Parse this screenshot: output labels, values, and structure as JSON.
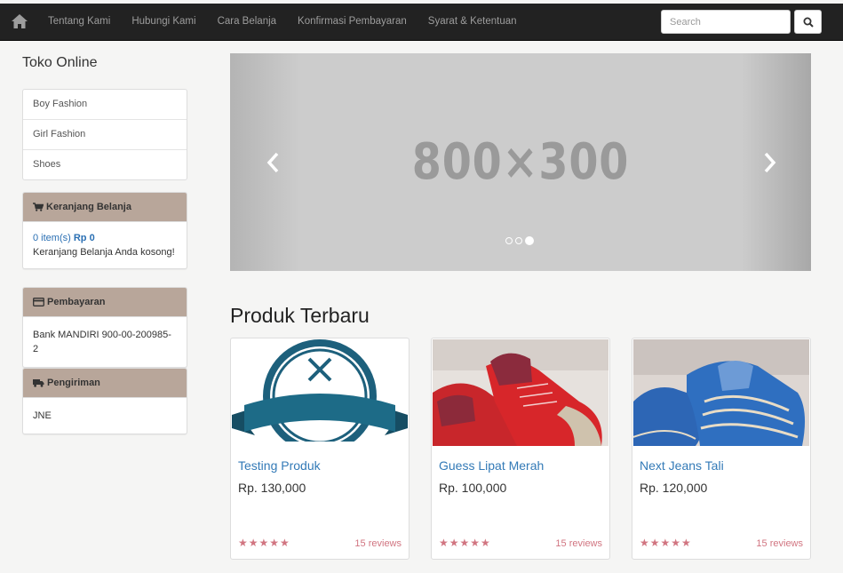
{
  "navbar": {
    "links": [
      "Tentang Kami",
      "Hubungi Kami",
      "Cara Belanja",
      "Konfirmasi Pembayaran",
      "Syarat & Ketentuan"
    ],
    "search_placeholder": "Search"
  },
  "sidebar": {
    "site_title": "Toko Online",
    "categories": [
      "Boy Fashion",
      "Girl Fashion",
      "Shoes"
    ],
    "cart": {
      "title": "Keranjang Belanja",
      "items_text": "0 item(s)",
      "total_text": "Rp 0",
      "empty_text": "Keranjang Belanja Anda kosong!"
    },
    "payment": {
      "title": "Pembayaran",
      "body": "Bank MANDIRI 900-00-200985-2"
    },
    "shipping": {
      "title": "Pengiriman",
      "body": "JNE"
    }
  },
  "carousel": {
    "placeholder_text": "800×300",
    "slide_count": 3,
    "active_slide": 3
  },
  "products": {
    "section_title": "Produk Terbaru",
    "items": [
      {
        "name": "Testing Produk",
        "price": "Rp. 130,000",
        "stars": "★★★★★",
        "reviews": "15 reviews"
      },
      {
        "name": "Guess Lipat Merah",
        "price": "Rp. 100,000",
        "stars": "★★★★★",
        "reviews": "15 reviews"
      },
      {
        "name": "Next Jeans Tali",
        "price": "Rp. 120,000",
        "stars": "★★★★★",
        "reviews": "15 reviews"
      }
    ]
  },
  "colors": {
    "navbar": "#222222",
    "panel_header": "#b8a69a",
    "link": "#337ab7",
    "stars": "#d17581"
  }
}
